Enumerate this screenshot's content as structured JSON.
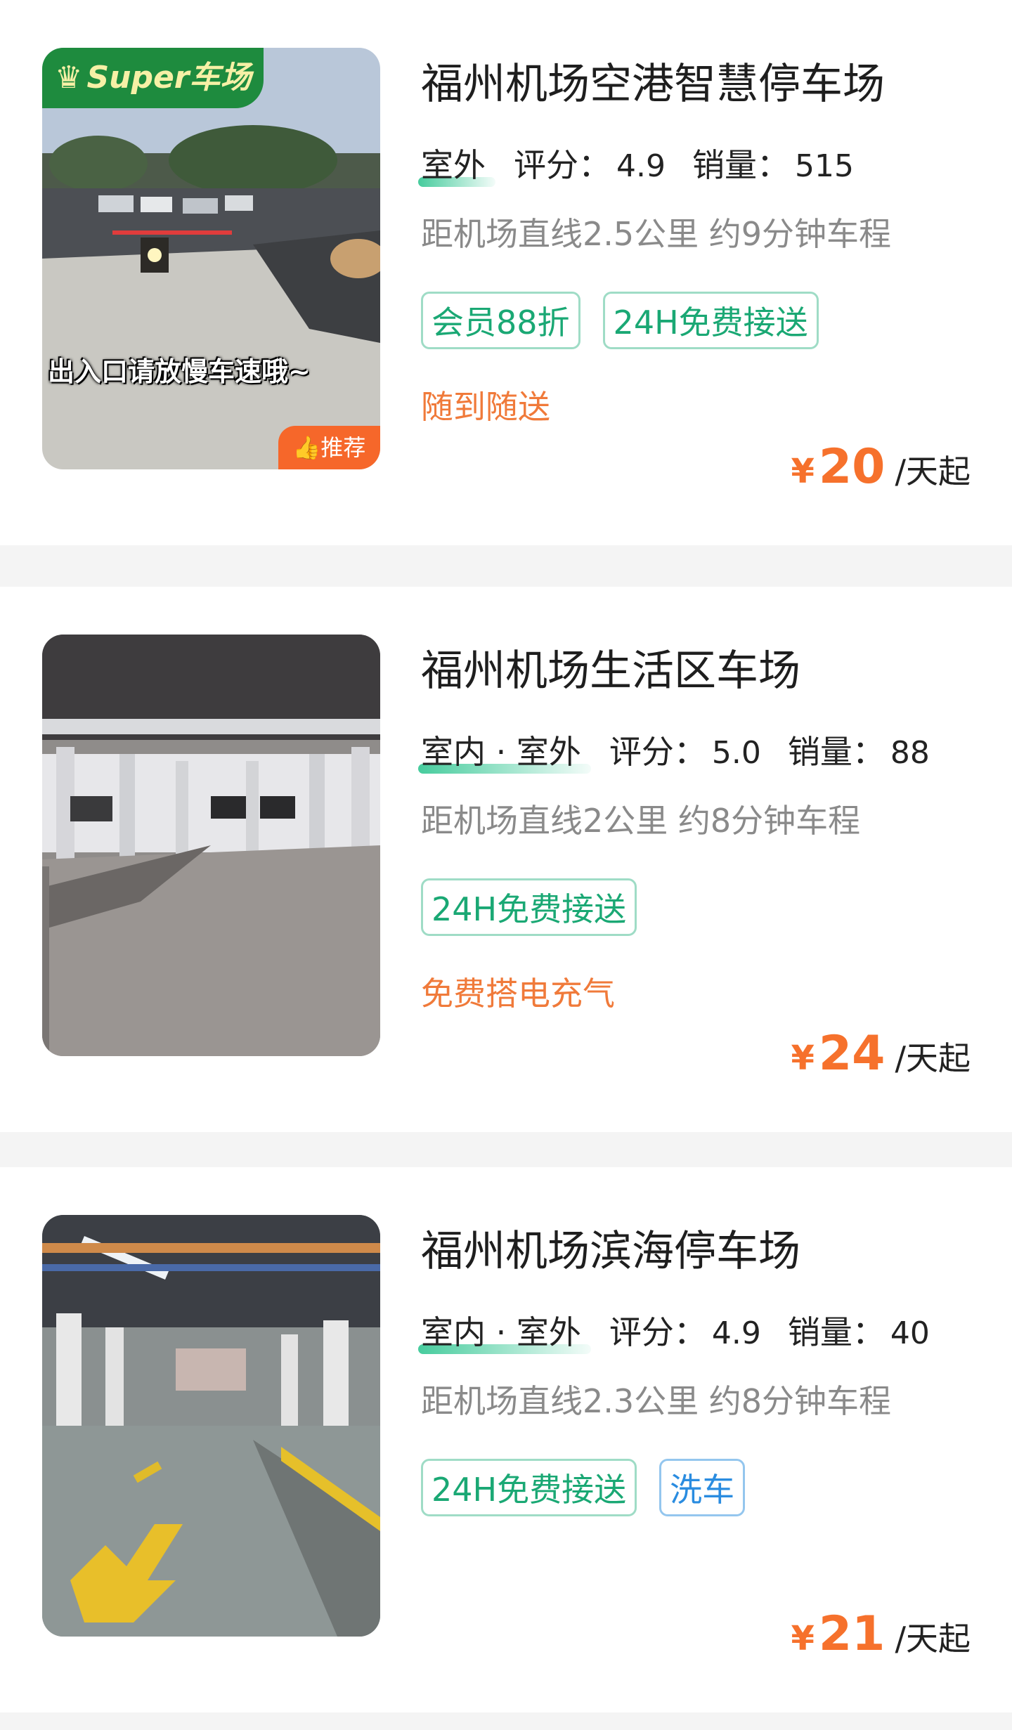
{
  "lots": [
    {
      "title": "福州机场空港智慧停车场",
      "type": "室外",
      "rating_label": "评分：",
      "rating": "4.9",
      "sales_label": "销量：",
      "sales": "515",
      "distance": "距机场直线2.5公里 约9分钟车程",
      "tags": [
        "会员88折",
        "24H免费接送"
      ],
      "service": "随到随送",
      "currency": "¥",
      "price": "20",
      "price_unit": "/天起",
      "badge": "Super车场",
      "photo_caption": "出入口请放慢车速哦~",
      "recommend": "推荐"
    },
    {
      "title": "福州机场生活区车场",
      "type": "室内 · 室外",
      "rating_label": "评分：",
      "rating": "5.0",
      "sales_label": "销量：",
      "sales": "88",
      "distance": "距机场直线2公里 约8分钟车程",
      "tags": [
        "24H免费接送"
      ],
      "service": "免费搭电充气",
      "currency": "¥",
      "price": "24",
      "price_unit": "/天起"
    },
    {
      "title": "福州机场滨海停车场",
      "type": "室内 · 室外",
      "rating_label": "评分：",
      "rating": "4.9",
      "sales_label": "销量：",
      "sales": "40",
      "distance": "距机场直线2.3公里 约8分钟车程",
      "tags": [
        "24H免费接送",
        "洗车"
      ],
      "service": "",
      "currency": "¥",
      "price": "21",
      "price_unit": "/天起"
    }
  ],
  "colors": {
    "accent_green": "#1aa874",
    "price_orange": "#f6712c",
    "service_orange": "#f07a3a",
    "wash_blue": "#2a8ce0"
  }
}
